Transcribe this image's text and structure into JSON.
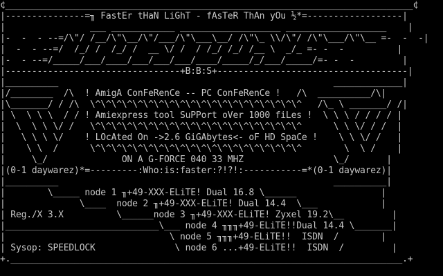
{
  "colors": {
    "background": "#000000",
    "text": "#c8c8c8"
  },
  "title_bar": {
    "left_glyph": "¢",
    "right_glyph": "¢"
  },
  "ansi_lines": [
    "¢_____________________________________________________________________________¢",
    "|---------------=╖ FastEr tHaN LiGhT - fAsTeR ThAn yOu ½*=------------------|",
    "|                ___ ____________ ___________________ ___________________    |",
    "|-  -  - --=/\\\"/ /__/\\\"\\__/\\\"/___/\\\"\\___\\__/ /\\\"\\_ \\\\/\\\"/ /\\\"\\___/\\\"\\__ =-  -  -|",
    "|  -  - --=/  /_/ /  /_/ /  __ \\/ /  / /_/ /_/ /__ \\  _/_ =- -  -          |",
    "|-  - --=/_____/___/____/___/___/___/____/_____/_/___/_____/=- -  -         |",
    "|---------------------------------+B:B:S+------------------------------------|",
    "|__________                                                    _____________|",
    "|/________  /\\  ! AmigA ConFeRenCe -- PC ConFeRenCe !   /\\  __________/\\|",
    "|\\_______/ / /\\  \\^\\^\\^\\^\\^\\^\\^\\^\\^\\^\\^\\^\\^\\^\\^\\^\\^\\^\\^\\^   /\\_ \\ _______/ /|",
    "| \\  \\ \\ \\  / / ! Amiexpress tool SuPPort oVer 1000 fiLes !  \\ \\ \\ / / / / |",
    "|  \\  \\ \\ \\/ /   \\^\\^\\^\\^\\^\\^\\^\\^\\^\\^\\^\\^\\^\\^\\^\\^\\^\\^\\^\\^      \\ \\ \\/ / /  |",
    "|   \\ \\ \\ \\/    ! LOcAted On ->2.6 GiGAbytes<- oF HD SpaCe !    \\ \\ \\/ /   |",
    "|    \\ \\  /      \\^\\^\\^\\^\\^\\^\\^\\^\\^\\^\\^\\^\\^\\^\\^\\^\\^\\^\\^\\^        \\  \\ /    |",
    "|     \\_/              ON A G-FORCE 040 33 MHZ                 \\_/       |",
    "|(0-1 daywarez)*=---------:Who:is:faster:?!?!:-----------=*(0-1 daywarez)|",
    "|__________                                                    __________|",
    "|        \\_____ node 1 ╖+49-XXX-ELiTE! Dual 16.8 \\______                |",
    "|              \\____  node 2 ╖+49-XXX-ELiTE! Dual 14.4  \\___            |",
    "| Reg./X 3.X          \\______node 3 ╖+49-XXX-ELiTE! Zyxel 19.2\\__         |",
    "|_____________________________\\___ node 4 ╖╖╖+49-ELiTE!!Dual 14.4 \\_______|",
    "|                               \\ node 5 ╖╖╖+49-ELiTE!!  ISDN  /        |",
    "| Sysop: SPEEDLOCK               \\ node 6 ...+49-ELiTE!!  ISDN  /         |",
    "+.__________________________________________________________________________.+"
  ]
}
